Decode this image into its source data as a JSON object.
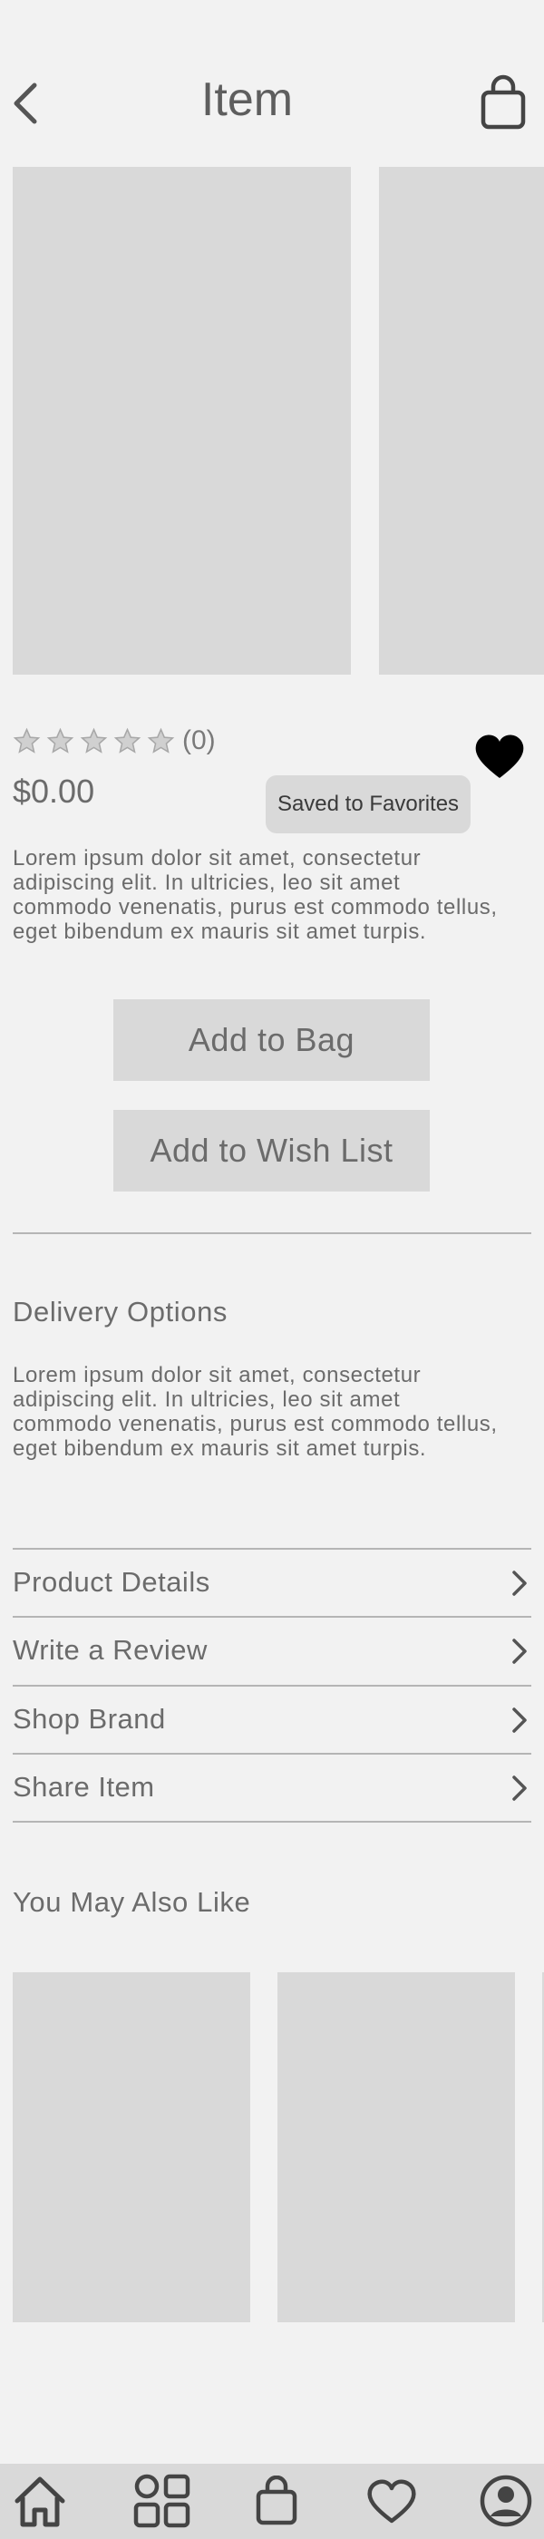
{
  "header": {
    "title": "Item",
    "back_icon": "chevron-left-icon",
    "bag_icon": "shopping-bag-icon"
  },
  "product": {
    "rating": 0,
    "review_count": "(0)",
    "price": "$0.00",
    "favorite": true,
    "saved_message": "Saved to Favorites",
    "description": "Lorem ipsum dolor sit amet, consectetur adipiscing elit. In ultricies, leo sit amet commodo venenatis, purus est commodo tellus, eget bibendum ex mauris sit amet turpis."
  },
  "actions": {
    "add_to_bag": "Add to Bag",
    "add_to_wish_list": "Add to Wish List"
  },
  "delivery": {
    "title": "Delivery Options",
    "text": "Lorem ipsum dolor sit amet, consectetur adipiscing elit. In ultricies, leo sit amet commodo venenatis, purus est commodo tellus, eget bibendum ex mauris sit amet turpis."
  },
  "links": [
    {
      "label": "Product Details"
    },
    {
      "label": "Write a Review"
    },
    {
      "label": "Shop Brand"
    },
    {
      "label": "Share Item"
    }
  ],
  "recommendations": {
    "title": "You May Also Like"
  },
  "bottom_nav": {
    "items": [
      "home-icon",
      "categories-grid-icon",
      "shopping-bag-icon",
      "heart-icon",
      "profile-icon"
    ]
  },
  "colors": {
    "background": "#f2f2f2",
    "placeholder": "#d9d9d9",
    "text": "#6b6b6b",
    "heart": "#000000"
  }
}
